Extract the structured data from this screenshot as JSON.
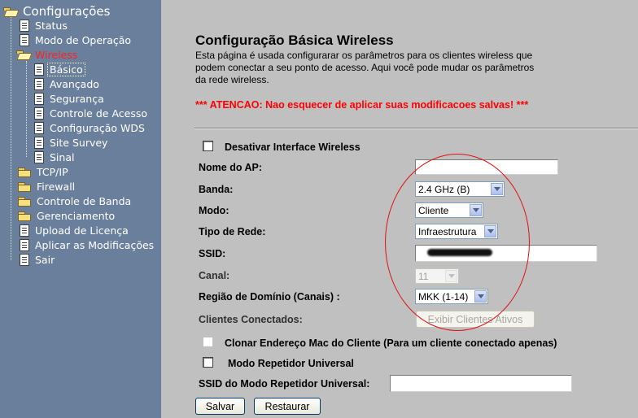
{
  "sidebar": {
    "root_label": "Configurações",
    "items": [
      {
        "label": "Status",
        "icon": "doc-icon"
      },
      {
        "label": "Modo de Operação",
        "icon": "doc-icon"
      },
      {
        "label": "Wireless",
        "icon": "folder-open-icon"
      },
      {
        "label": "Básico",
        "icon": "doc-icon"
      },
      {
        "label": "Avançado",
        "icon": "doc-icon"
      },
      {
        "label": "Segurança",
        "icon": "doc-icon"
      },
      {
        "label": "Controle de Acesso",
        "icon": "doc-icon"
      },
      {
        "label": "Configuração WDS",
        "icon": "doc-icon"
      },
      {
        "label": "Site Survey",
        "icon": "doc-icon"
      },
      {
        "label": "Sinal",
        "icon": "doc-icon"
      },
      {
        "label": "TCP/IP",
        "icon": "folder-icon"
      },
      {
        "label": "Firewall",
        "icon": "folder-icon"
      },
      {
        "label": "Controle de Banda",
        "icon": "folder-icon"
      },
      {
        "label": "Gerenciamento",
        "icon": "folder-icon"
      },
      {
        "label": "Upload de Licença",
        "icon": "doc-icon"
      },
      {
        "label": "Aplicar as Modificações",
        "icon": "doc-icon"
      },
      {
        "label": "Sair",
        "icon": "doc-icon"
      }
    ]
  },
  "main": {
    "title": "Configuração Básica Wireless",
    "description": "Esta página é usada configurarar os parâmetros para os clientes wireless que podem conectar a seu ponto de acesso. Aqui você pode mudar os parâmetros da rede wireless.",
    "warning": "*** ATENCAO: Nao esquecer de aplicar suas modificacoes salvas! ***",
    "form": {
      "disable_label": "Desativar Interface Wireless",
      "ap_name_label": "Nome do AP:",
      "ap_name_value": "",
      "band_label": "Banda:",
      "band_value": "2.4 GHz (B)",
      "mode_label": "Modo:",
      "mode_value": "Cliente",
      "network_type_label": "Tipo de Rede:",
      "network_type_value": "Infraestrutura",
      "ssid_label": "SSID:",
      "channel_label": "Canal:",
      "channel_value": "11",
      "domain_label": "Região de Domínio (Canais) :",
      "domain_value": "MKK (1-14)",
      "clients_label": "Clientes Conectados:",
      "clients_button": "Exibir Clientes Ativos",
      "clone_mac_label": "Clonar Endereço Mac do Cliente (Para um cliente conectado apenas)",
      "repeater_label": "Modo Repetidor Universal",
      "repeater_ssid_label": "SSID do Modo Repetidor Universal:",
      "repeater_ssid_value": ""
    },
    "buttons": {
      "save": "Salvar",
      "reset": "Restaurar"
    }
  },
  "colors": {
    "sidebar_bg": "#6a7f9b",
    "content_bg": "#c0c0c0",
    "warning": "#ff0000",
    "active_menu": "#ff2020",
    "annotation": "#e01010"
  }
}
